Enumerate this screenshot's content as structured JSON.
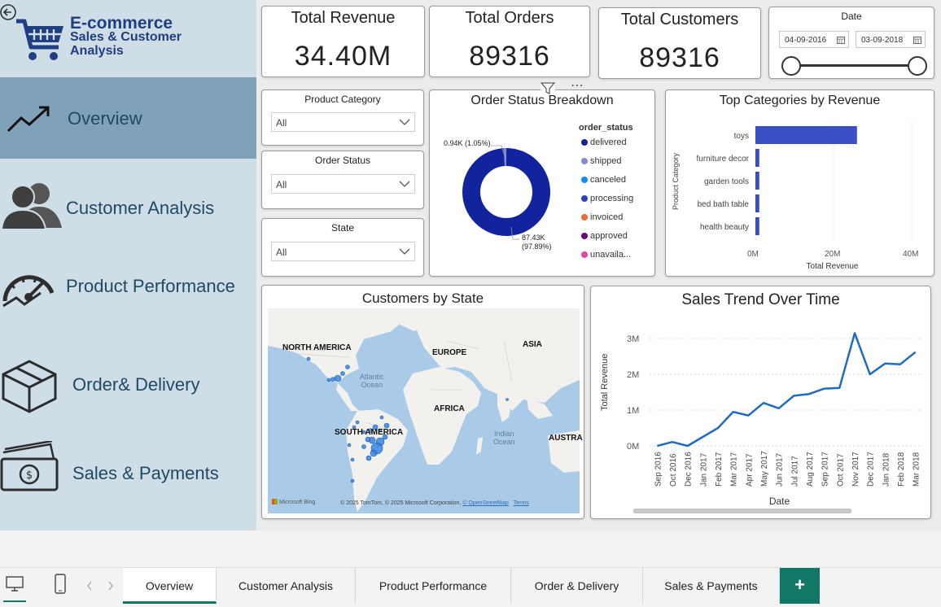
{
  "logo": {
    "line1": "E-commerce",
    "line2": "Sales & Customer",
    "line3": "Analysis"
  },
  "nav": [
    {
      "label": "Overview",
      "icon": "trend-icon",
      "active": true
    },
    {
      "label": "Customer Analysis",
      "icon": "users-icon",
      "active": false
    },
    {
      "label": "Product Performance",
      "icon": "speedometer-icon",
      "active": false
    },
    {
      "label": "Order& Delivery",
      "icon": "box-icon",
      "active": false
    },
    {
      "label": "Sales & Payments",
      "icon": "cash-icon",
      "active": false
    }
  ],
  "kpis": {
    "revenue": {
      "title": "Total Revenue",
      "value": "34.40M"
    },
    "orders": {
      "title": "Total Orders",
      "value": "89316"
    },
    "customers": {
      "title": "Total Customers",
      "value": "89316"
    }
  },
  "date_slicer": {
    "title": "Date",
    "start": "04-09-2016",
    "end": "03-09-2018"
  },
  "slicers": {
    "category": {
      "title": "Product Category",
      "value": "All"
    },
    "status": {
      "title": "Order Status",
      "value": "All"
    },
    "state": {
      "title": "State",
      "value": "All"
    }
  },
  "order_status": {
    "title": "Order Status Breakdown",
    "legend_title": "order_status",
    "small_label": "0.94K (1.05%)",
    "big_label_1": "87.43K",
    "big_label_2": "(97.89%)",
    "legend": [
      {
        "label": "delivered",
        "color": "#12239e"
      },
      {
        "label": "shipped",
        "color": "#7f8cd1"
      },
      {
        "label": "canceled",
        "color": "#118dff"
      },
      {
        "label": "processing",
        "color": "#2b3fbf"
      },
      {
        "label": "invoiced",
        "color": "#e66c37"
      },
      {
        "label": "approved",
        "color": "#6b007b"
      },
      {
        "label": "unavaila...",
        "color": "#e044a7"
      }
    ]
  },
  "top_categories": {
    "title": "Top Categories by Revenue",
    "ylabel": "Product Category",
    "xlabel": "Total Revenue",
    "ticks": [
      "0M",
      "20M",
      "40M"
    ]
  },
  "map": {
    "title": "Customers by State",
    "labels": {
      "north_america": "NORTH AMERICA",
      "europe": "EUROPE",
      "asia": "ASIA",
      "africa": "AFRICA",
      "south_america": "SOUTH AMERICA",
      "australia": "AUSTRA",
      "atlantic_1": "Atlantic",
      "atlantic_2": "Ocean",
      "indian_1": "Indian",
      "indian_2": "Ocean"
    },
    "attribution": "© 2025 TomTom, © 2025 Microsoft Corporation,",
    "osm": "© OpenStreetMap",
    "terms": "Terms",
    "bing": "Microsoft Bing"
  },
  "trend": {
    "title": "Sales Trend Over Time"
  },
  "tabs": [
    "Overview",
    "Customer Analysis",
    "Product Performance",
    "Order & Delivery",
    "Sales & Payments"
  ],
  "add_tab": "+",
  "chart_data": [
    {
      "type": "pie",
      "title": "Order Status Breakdown",
      "categories": [
        "delivered",
        "shipped",
        "canceled",
        "processing",
        "invoiced",
        "approved",
        "unavaila..."
      ],
      "values": [
        87.43,
        0.94,
        0.4,
        0.3,
        0.2,
        0.02,
        0.01
      ],
      "annotations": [
        "0.94K (1.05%)",
        "87.43K (97.89%)"
      ]
    },
    {
      "type": "bar",
      "title": "Top Categories by Revenue",
      "categories": [
        "toys",
        "furniture decor",
        "garden tools",
        "bed bath table",
        "health beauty"
      ],
      "values": [
        26,
        1,
        1,
        1,
        1
      ],
      "xlabel": "Total Revenue",
      "ylabel": "Product Category",
      "xlim": [
        0,
        40
      ],
      "ticks": [
        "0M",
        "20M",
        "40M"
      ]
    },
    {
      "type": "line",
      "title": "Sales Trend Over Time",
      "xlabel": "Date",
      "ylabel": "Total Revenue",
      "x": [
        "Sep 2016",
        "Oct 2016",
        "Dec 2016",
        "Jan 2017",
        "Feb 2017",
        "Mar 2017",
        "Apr 2017",
        "May 2017",
        "Jun 2017",
        "Jul 2017",
        "Aug 2017",
        "Sep 2017",
        "Oct 2017",
        "Nov 2017",
        "Dec 2017",
        "Jan 2018",
        "Feb 2018",
        "Mar 2018"
      ],
      "series": [
        {
          "values": [
            0.0,
            0.11,
            0.0,
            0.25,
            0.5,
            0.95,
            0.85,
            1.2,
            1.05,
            1.4,
            1.45,
            1.6,
            1.62,
            3.15,
            2.0,
            2.3,
            2.28,
            2.62
          ]
        }
      ],
      "ylim": [
        0,
        3
      ],
      "yticks": [
        "0M",
        "1M",
        "2M",
        "3M"
      ],
      "grid": true
    }
  ]
}
